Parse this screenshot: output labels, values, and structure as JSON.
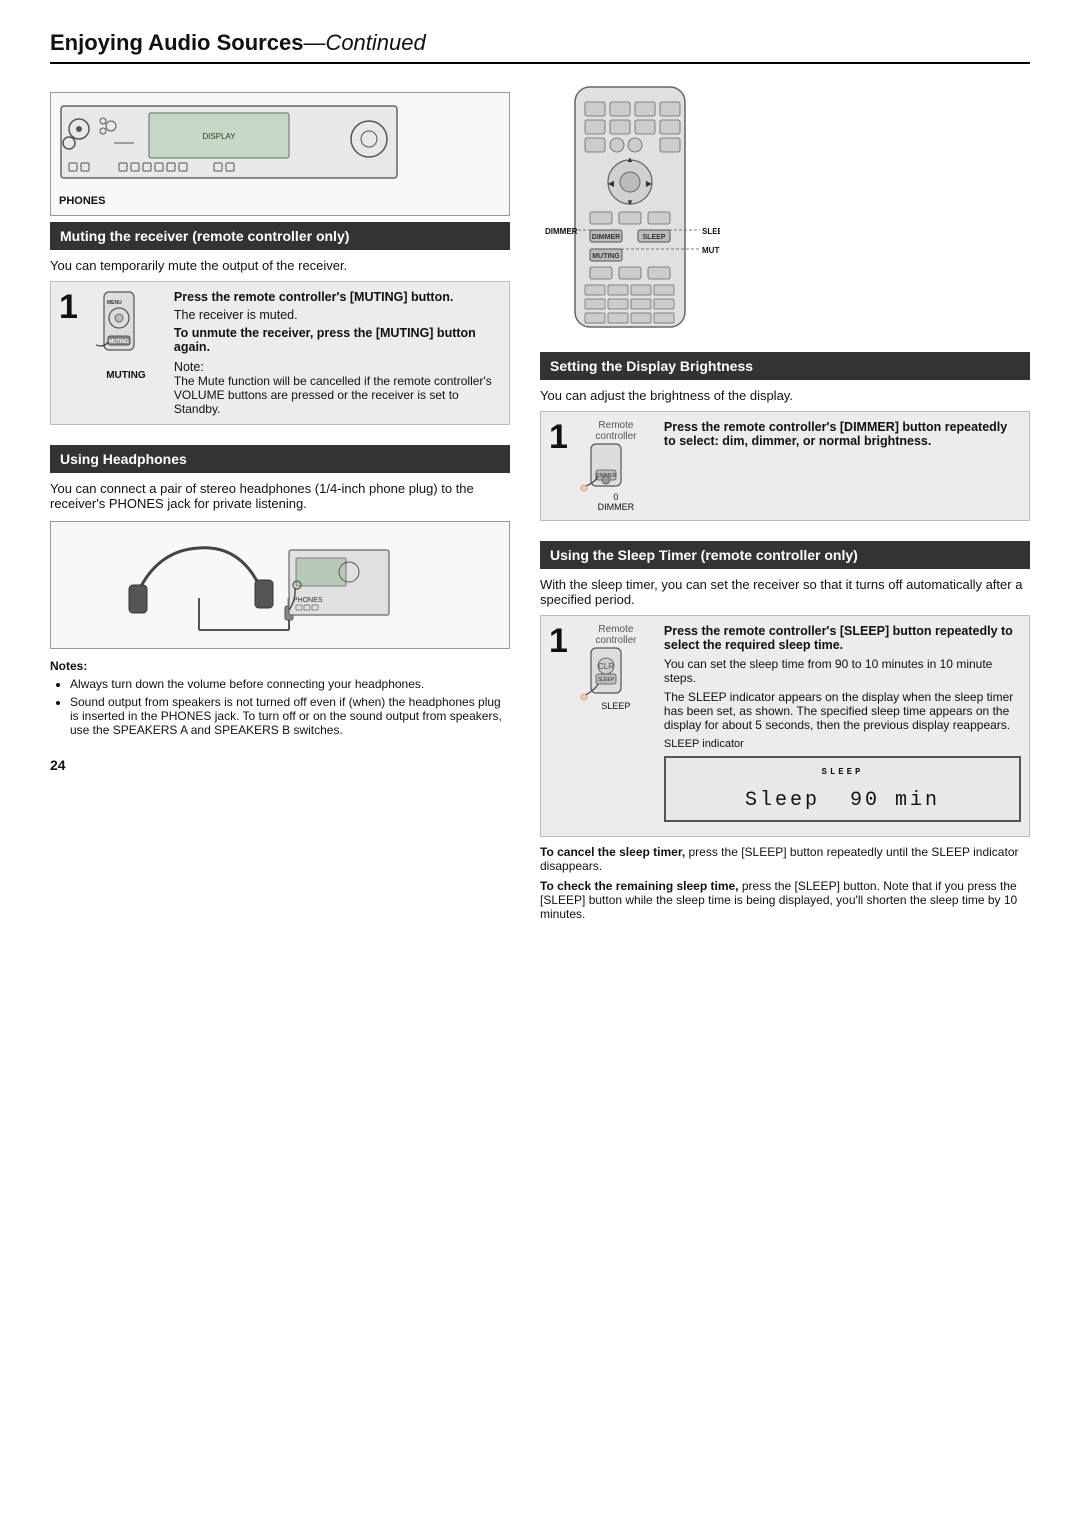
{
  "page": {
    "title": "Enjoying Audio Sources",
    "title_suffix": "—Continued",
    "page_number": "24"
  },
  "left_col": {
    "section1": {
      "header": "Muting the receiver (remote controller only)",
      "intro": "You can temporarily mute the output of the receiver.",
      "step1": {
        "number": "1",
        "bold": "Press the remote controller's [MUTING] button.",
        "line2": "The receiver is muted.",
        "bold2": "To unmute the receiver, press the [MUTING] button again.",
        "note_label": "Note:",
        "note_text": "The Mute function will be cancelled if the remote controller's VOLUME buttons are pressed or the receiver is set to Standby."
      }
    },
    "section2": {
      "header": "Using Headphones",
      "intro": "You can connect a pair of stereo headphones (1/4-inch phone plug) to the receiver's PHONES jack for private listening.",
      "notes_label": "Notes:",
      "notes": [
        "Always turn down the volume before connecting your headphones.",
        "Sound output from speakers is not turned off even if (when) the headphones plug is inserted in the PHONES jack. To turn off or on the sound output from speakers, use the SPEAKERS A and SPEAKERS B switches."
      ]
    }
  },
  "right_col": {
    "labels": {
      "dimmer": "DIMMER",
      "sleep": "SLEEP",
      "muting": "MUTING"
    },
    "section1": {
      "header": "Setting the Display Brightness",
      "intro": "You can adjust the brightness of the display.",
      "step1": {
        "number": "1",
        "icon_label1": "Remote",
        "icon_label2": "controller",
        "bold": "Press the remote controller's [DIMMER] button repeatedly to select: dim, dimmer, or normal brightness."
      }
    },
    "section2": {
      "header": "Using the Sleep Timer (remote controller only)",
      "intro": "With the sleep timer, you can set the receiver so that it turns off automatically after a specified period.",
      "step1": {
        "number": "1",
        "icon_label1": "Remote",
        "icon_label2": "controller",
        "bold": "Press the remote controller's [SLEEP] button repeatedly to select the required sleep time.",
        "para1": "You can set the sleep time from 90 to 10 minutes in 10 minute steps.",
        "para2": "The SLEEP indicator appears on the display when the sleep timer has been set, as shown. The specified sleep time appears on the display for about 5 seconds, then the previous display reappears.",
        "sleep_indicator_label": "SLEEP indicator",
        "sleep_display": "Sleep 90 min"
      },
      "note1_bold": "To cancel the sleep timer,",
      "note1": " press the [SLEEP] button repeatedly until the SLEEP indicator disappears.",
      "note2_bold": "To check the remaining sleep time,",
      "note2": " press the [SLEEP] button. Note that if you press the [SLEEP] button while the sleep time is being displayed, you'll shorten the sleep time by 10 minutes."
    }
  },
  "phones_label": "PHONES"
}
